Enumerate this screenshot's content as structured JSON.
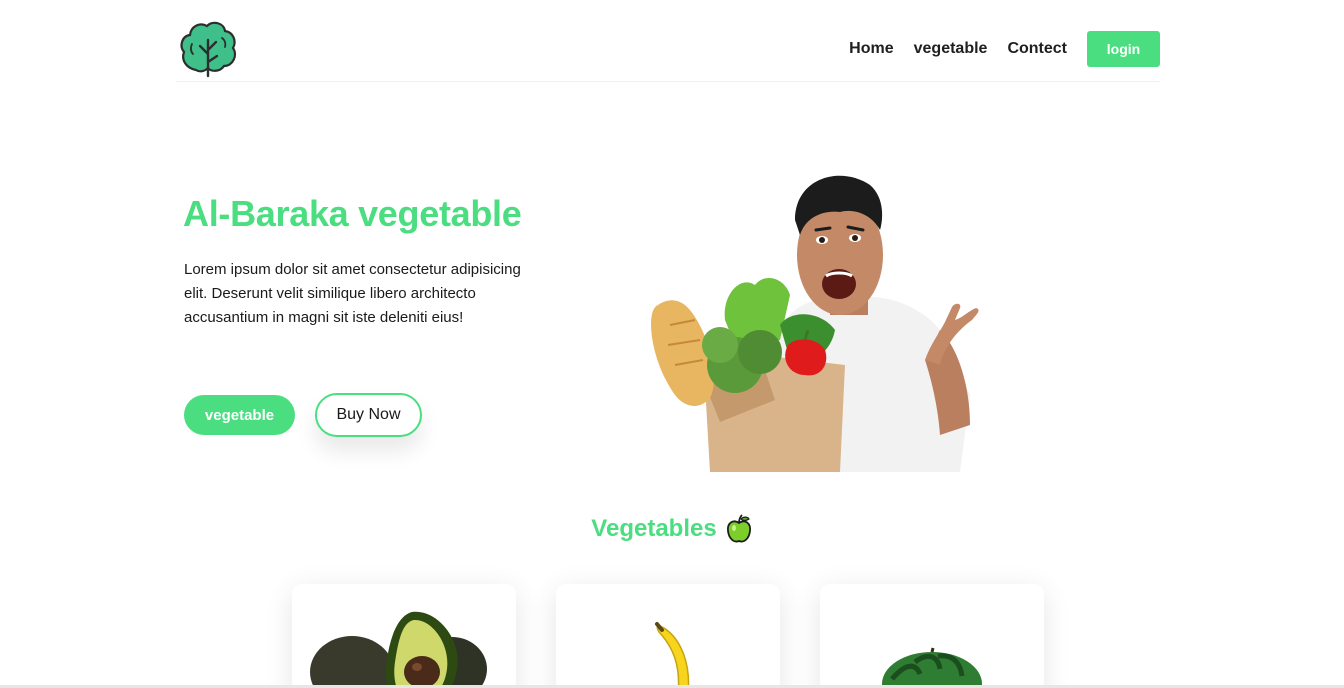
{
  "nav": {
    "logo_icon": "broccoli-logo-icon",
    "links": [
      "Home",
      "vegetable",
      "Contect"
    ],
    "login_label": "login"
  },
  "hero": {
    "title": "Al-Baraka vegetable",
    "description": "Lorem ipsum dolor sit amet consectetur adipisicing elit. Deserunt velit similique libero architecto accusantium in magni sit iste deleniti eius!",
    "primary_button": "vegetable",
    "secondary_button": "Buy Now",
    "image": "man-with-grocery-bag-image"
  },
  "section": {
    "title": "Vegetables",
    "icon": "green-apple-icon"
  },
  "cards": [
    {
      "image": "avocado-image"
    },
    {
      "image": "banana-image"
    },
    {
      "image": "watermelon-image"
    }
  ],
  "colors": {
    "accent": "#4ade80",
    "text": "#1a1a1a",
    "background": "#ffffff"
  }
}
